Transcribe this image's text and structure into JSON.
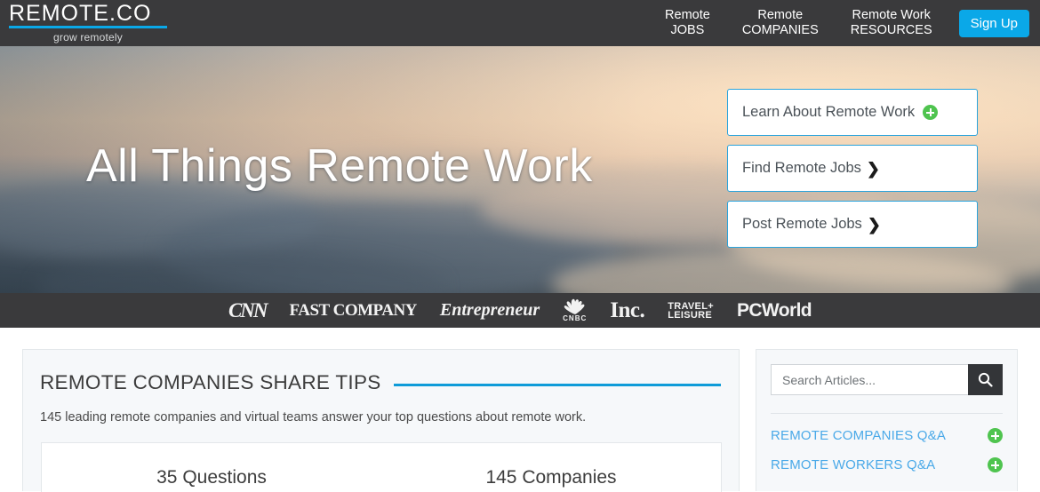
{
  "header": {
    "logo_word": "REMOTE.CO",
    "logo_tagline": "grow remotely",
    "nav": [
      {
        "line1": "Remote",
        "line2": "JOBS"
      },
      {
        "line1": "Remote",
        "line2": "COMPANIES"
      },
      {
        "line1": "Remote Work",
        "line2": "RESOURCES"
      }
    ],
    "signup_label": "Sign Up",
    "accent_blue": "#0aa8e8",
    "bar_color": "#3a3a3c"
  },
  "hero": {
    "title": "All Things Remote Work",
    "ctas": [
      {
        "label": "Learn About Remote Work",
        "icon": "plus-circle-icon"
      },
      {
        "label": "Find Remote Jobs",
        "icon": "chevron-right-icon"
      },
      {
        "label": "Post Remote Jobs",
        "icon": "chevron-right-icon"
      }
    ],
    "border_color": "#29a3dc",
    "plus_color": "#4fc44f"
  },
  "press": {
    "logos": [
      "CNN",
      "FAST COMPANY",
      "Entrepreneur",
      "CNBC",
      "Inc.",
      "TRAVEL+ LEISURE",
      "PCWorld"
    ],
    "travel_line1": "TRAVEL+",
    "travel_line2": "LEISURE",
    "cnbc_word": "CNBC"
  },
  "main": {
    "title": "REMOTE COMPANIES SHARE TIPS",
    "subtitle": "145 leading remote companies and virtual teams answer your top questions about remote work.",
    "stats": [
      "35 Questions",
      "145 Companies"
    ],
    "rule_color": "#0e9bd8"
  },
  "sidebar": {
    "search_placeholder": "Search Articles...",
    "search_value": "",
    "search_icon": "magnifier-icon",
    "links": [
      {
        "label": "REMOTE COMPANIES Q&A",
        "icon": "plus-circle-icon"
      },
      {
        "label": "REMOTE WORKERS Q&A",
        "icon": "plus-circle-icon"
      }
    ],
    "link_color": "#4aa9e8"
  }
}
